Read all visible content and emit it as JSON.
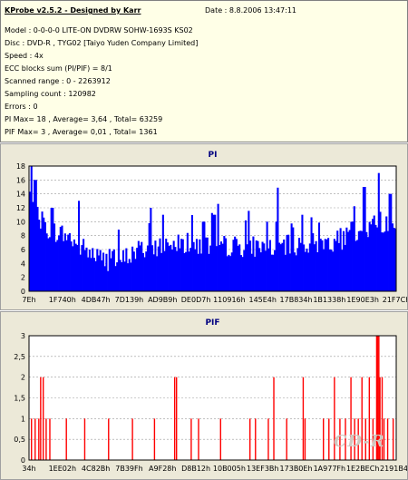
{
  "info": {
    "title": "KProbe v2.5.2 - Designed by Karr",
    "date": "Date : 8.8.2006 13:47:11",
    "lines": [
      "Model : 0-0-0-0 LITE-ON DVDRW SOHW-1693S KS02",
      "Disc : DVD-R , TYG02 [Taiyo Yuden Company Limited]",
      "Speed : 4x",
      "ECC blocks sum (PI/PIF) = 8/1",
      "Scanned range : 0 - 2263912",
      "Sampling count : 120982",
      "Errors : 0",
      "PI Max= 18 , Average= 3,64 , Total= 63259",
      "PIF Max= 3 , Average= 0,01 , Total= 1361"
    ]
  },
  "watermark": "CD-R",
  "chart_data": [
    {
      "type": "bar",
      "title": "PI",
      "bar_color": "#0000ff",
      "ylim": [
        0,
        18
      ],
      "y_ticks": [
        "0",
        "2",
        "4",
        "6",
        "8",
        "10",
        "12",
        "14",
        "16",
        "18"
      ],
      "x_tick_labels": [
        "7Eh",
        "1F740h",
        "4DB47h",
        "7D139h",
        "AD9B9h",
        "DE0D7h",
        "110916h",
        "145E4h",
        "17B834h",
        "1B1338h",
        "1E90E3h",
        "21F7Ch"
      ],
      "grid": true,
      "profile": {
        "x": [
          0,
          0.02,
          0.05,
          0.1,
          0.15,
          0.2,
          0.25,
          0.3,
          0.4,
          0.5,
          0.6,
          0.7,
          0.8,
          0.9,
          0.95,
          0.975,
          1.0
        ],
        "base": [
          14,
          11,
          9,
          8,
          6,
          4.5,
          4.5,
          6,
          7,
          6.5,
          6.5,
          6.5,
          7,
          8,
          10,
          10,
          8.5
        ]
      },
      "peaks": [
        {
          "x": 0.005,
          "v": 18
        },
        {
          "x": 0.015,
          "v": 16
        },
        {
          "x": 0.06,
          "v": 12
        },
        {
          "x": 0.135,
          "v": 13
        },
        {
          "x": 0.33,
          "v": 12
        },
        {
          "x": 0.365,
          "v": 11
        },
        {
          "x": 0.475,
          "v": 10
        },
        {
          "x": 0.505,
          "v": 11
        },
        {
          "x": 0.675,
          "v": 10
        },
        {
          "x": 0.745,
          "v": 11
        },
        {
          "x": 0.88,
          "v": 10
        },
        {
          "x": 0.915,
          "v": 15
        },
        {
          "x": 0.955,
          "v": 17
        },
        {
          "x": 0.985,
          "v": 14
        }
      ]
    },
    {
      "type": "bar",
      "title": "PIF",
      "bar_color": "#ff0000",
      "ylim": [
        0,
        3
      ],
      "y_ticks": [
        "0",
        "0,5",
        "1",
        "1,5",
        "2",
        "2,5",
        "3"
      ],
      "x_tick_labels": [
        "34h",
        "1EE02h",
        "4C82Bh",
        "7B39Fh",
        "A9F28h",
        "D8B12h",
        "10B005h",
        "13EF3Bh",
        "173B0Eh",
        "1A977Fh",
        "1E2BECh",
        "2191B4h"
      ],
      "grid": true,
      "spikes": [
        {
          "x": 0.005,
          "v": 1
        },
        {
          "x": 0.015,
          "v": 1
        },
        {
          "x": 0.025,
          "v": 1
        },
        {
          "x": 0.03,
          "v": 2
        },
        {
          "x": 0.037,
          "v": 2
        },
        {
          "x": 0.045,
          "v": 1
        },
        {
          "x": 0.055,
          "v": 1
        },
        {
          "x": 0.1,
          "v": 1
        },
        {
          "x": 0.15,
          "v": 1
        },
        {
          "x": 0.215,
          "v": 1
        },
        {
          "x": 0.28,
          "v": 1
        },
        {
          "x": 0.34,
          "v": 1
        },
        {
          "x": 0.395,
          "v": 2
        },
        {
          "x": 0.4,
          "v": 2
        },
        {
          "x": 0.44,
          "v": 1
        },
        {
          "x": 0.46,
          "v": 1
        },
        {
          "x": 0.52,
          "v": 1
        },
        {
          "x": 0.6,
          "v": 1
        },
        {
          "x": 0.615,
          "v": 1
        },
        {
          "x": 0.65,
          "v": 1
        },
        {
          "x": 0.665,
          "v": 2
        },
        {
          "x": 0.7,
          "v": 1
        },
        {
          "x": 0.745,
          "v": 2
        },
        {
          "x": 0.75,
          "v": 1
        },
        {
          "x": 0.8,
          "v": 1
        },
        {
          "x": 0.815,
          "v": 1
        },
        {
          "x": 0.83,
          "v": 2
        },
        {
          "x": 0.845,
          "v": 1
        },
        {
          "x": 0.86,
          "v": 1
        },
        {
          "x": 0.875,
          "v": 2
        },
        {
          "x": 0.885,
          "v": 1
        },
        {
          "x": 0.895,
          "v": 1
        },
        {
          "x": 0.905,
          "v": 2
        },
        {
          "x": 0.915,
          "v": 1
        },
        {
          "x": 0.925,
          "v": 2
        },
        {
          "x": 0.935,
          "v": 1
        },
        {
          "x": 0.945,
          "v": 3
        },
        {
          "x": 0.948,
          "v": 3
        },
        {
          "x": 0.951,
          "v": 3
        },
        {
          "x": 0.954,
          "v": 2
        },
        {
          "x": 0.96,
          "v": 2
        },
        {
          "x": 0.965,
          "v": 1
        },
        {
          "x": 0.975,
          "v": 1
        },
        {
          "x": 0.99,
          "v": 1
        }
      ]
    }
  ]
}
